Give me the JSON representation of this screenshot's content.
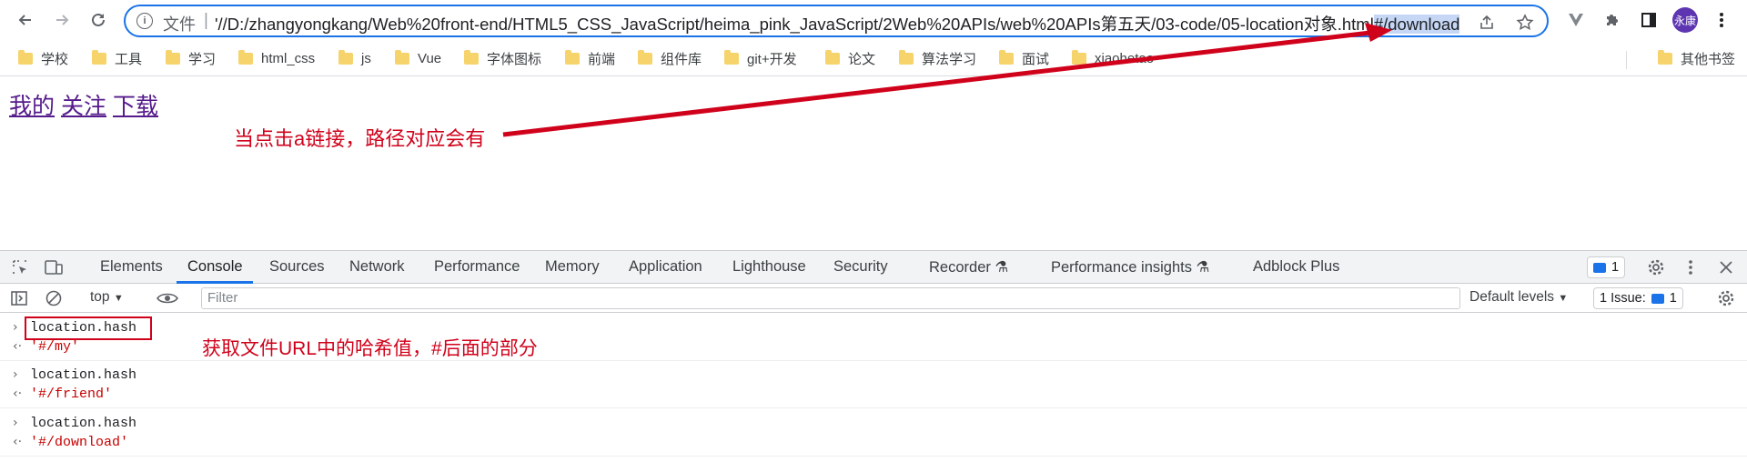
{
  "browser": {
    "url_prefix": "文件",
    "url_text": "'//D:/zhangyongkang/Web%20front-end/HTML5_CSS_JavaScript/heima_pink_JavaScript/2Web%20APIs/web%20APIs第五天/03-code/05-location对象.html",
    "url_hash": "#/download",
    "profile_label": "永康"
  },
  "bookmarks": {
    "items": [
      "学校",
      "工具",
      "学习",
      "html_css",
      "js",
      "Vue",
      "字体图标",
      "前端",
      "组件库",
      "git+开发",
      "论文",
      "算法学习",
      "面试",
      "xiaohetao"
    ],
    "other": "其他书签"
  },
  "page": {
    "links": [
      "我的",
      "关注",
      "下载"
    ],
    "annotation_top": "当点击a链接，路径对应会有",
    "annotation_console": "获取文件URL中的哈希值，#后面的部分"
  },
  "devtools": {
    "tabs": [
      "Elements",
      "Console",
      "Sources",
      "Network",
      "Performance",
      "Memory",
      "Application",
      "Lighthouse",
      "Security",
      "Recorder",
      "Performance insights",
      "Adblock Plus"
    ],
    "active_tab": "Console",
    "message_count": "1",
    "context": "top",
    "filter_placeholder": "Filter",
    "levels": "Default levels",
    "issues_label": "1 Issue:",
    "issues_count": "1",
    "console_entries": [
      {
        "input": "location.hash",
        "output": "'#/my'"
      },
      {
        "input": "location.hash",
        "output": "'#/friend'"
      },
      {
        "input": "location.hash",
        "output": "'#/download'"
      }
    ]
  },
  "colors": {
    "annotation": "#d0021b",
    "focus": "#1a73e8",
    "link_visited": "#551a8b",
    "string_result": "#c80000"
  }
}
